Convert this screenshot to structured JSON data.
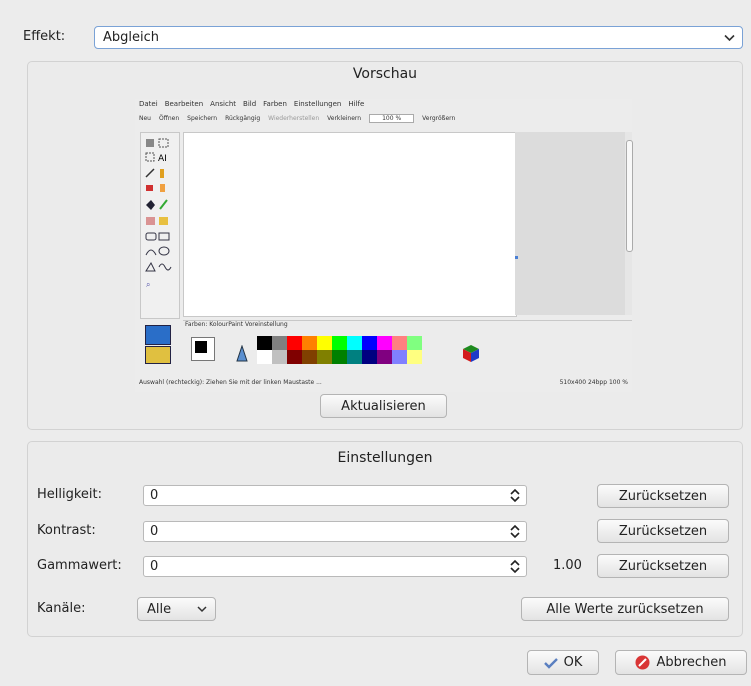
{
  "effekt": {
    "label": "Effekt:",
    "value": "Abgleich"
  },
  "preview": {
    "title": "Vorschau",
    "update_button": "Aktualisieren",
    "shot": {
      "menu": [
        "Datei",
        "Bearbeiten",
        "Ansicht",
        "Bild",
        "Farben",
        "Einstellungen",
        "Hilfe"
      ],
      "toolbar": [
        "Neu",
        "Öffnen",
        "Speichern",
        "Rückgängig",
        "Wiederherstellen",
        "Verkleinern",
        "100 %",
        "Vergrößern"
      ],
      "colors_label": "Farben: KolourPaint Voreinstellung",
      "status_left": "Auswahl (rechteckig): Ziehen Sie mit der linken Maustaste ...",
      "status_right": "510x400   24bpp  100 %",
      "palette_top": [
        "#000000",
        "#808080",
        "#ff0000",
        "#ff8000",
        "#ffff00",
        "#00ff00",
        "#00ffff",
        "#0000ff",
        "#ff00ff",
        "#ff8080",
        "#80ff80"
      ],
      "palette_bottom": [
        "#ffffff",
        "#c0c0c0",
        "#800000",
        "#804000",
        "#808000",
        "#008000",
        "#008080",
        "#000080",
        "#800080",
        "#8080ff",
        "#ffff80"
      ]
    }
  },
  "settings": {
    "title": "Einstellungen",
    "rows": [
      {
        "label": "Helligkeit:",
        "value": "0",
        "extra": "",
        "reset": "Zurücksetzen"
      },
      {
        "label": "Kontrast:",
        "value": "0",
        "extra": "",
        "reset": "Zurücksetzen"
      },
      {
        "label": "Gammawert:",
        "value": "0",
        "extra": "1.00",
        "reset": "Zurücksetzen"
      }
    ],
    "channels": {
      "label": "Kanäle:",
      "value": "Alle"
    },
    "reset_all": "Alle Werte zurücksetzen"
  },
  "buttons": {
    "ok": "OK",
    "cancel": "Abbrechen"
  },
  "colors": {
    "accent": "#3b73c4",
    "cancel_icon": "#d93535",
    "ok_icon": "#5a7fc0"
  }
}
